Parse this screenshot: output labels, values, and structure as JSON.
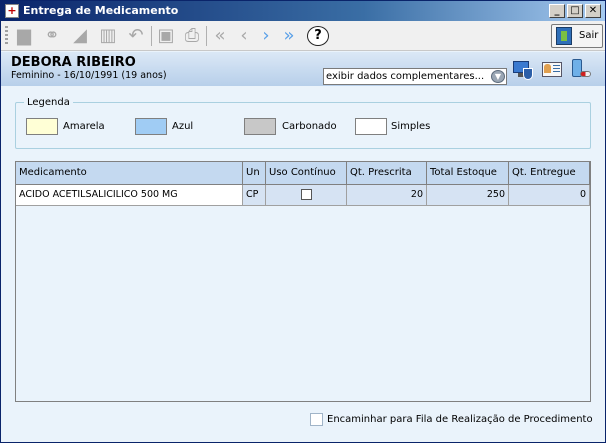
{
  "window": {
    "title": "Entrega de Medicamento",
    "title_icon": "+",
    "controls": [
      "_",
      "□",
      "✕"
    ]
  },
  "toolbar": {
    "icons": [
      "new-icon",
      "binoculars-icon",
      "eraser-icon",
      "trash-icon",
      "undo-icon",
      "save-icon",
      "print-icon",
      "first-icon",
      "previous-icon",
      "next-icon",
      "last-icon",
      "help-icon"
    ],
    "help_label": "?",
    "exit_label": "Sair"
  },
  "patient": {
    "name": "DEBORA RIBEIRO",
    "info": "Feminino - 16/10/1991 (19 anos)",
    "complement_select": "exibir dados complementares..."
  },
  "legend": {
    "title": "Legenda",
    "items": [
      {
        "label": "Amarela",
        "color": "#ffffd6"
      },
      {
        "label": "Azul",
        "color": "#a0ccf4"
      },
      {
        "label": "Carbonado",
        "color": "#c8c8c8"
      },
      {
        "label": "Simples",
        "color": "#ffffff"
      }
    ]
  },
  "grid": {
    "columns": [
      "Medicamento",
      "Un",
      "Uso Contínuo",
      "Qt. Prescrita",
      "Total Estoque",
      "Qt. Entregue"
    ],
    "rows": [
      {
        "medicamento": "ACIDO ACETILSALICILICO 500 MG",
        "un": "CP",
        "uso_continuo": false,
        "qt_prescrita": "20",
        "total_estoque": "250",
        "qt_entregue": "0"
      }
    ]
  },
  "footer": {
    "forward_label": "Encaminhar para Fila de Realização de Procedimento",
    "forward_checked": false
  },
  "colors": {
    "titlebar_start": "#0a246a",
    "header_bg": "#c4d9f0",
    "window_bg": "#eaf3fb"
  }
}
